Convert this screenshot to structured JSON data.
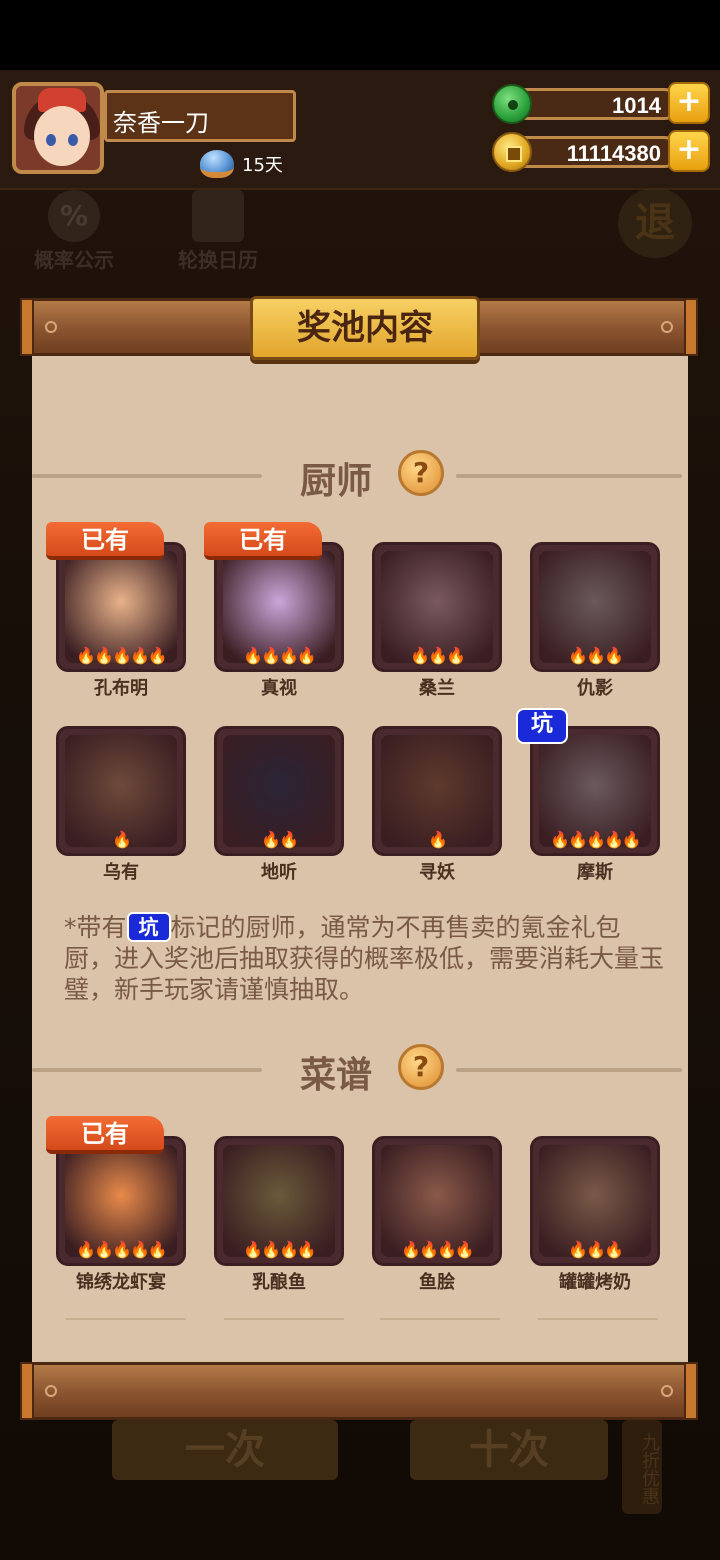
{
  "player": {
    "name": "奈香一刀",
    "days_label": "15天",
    "jade": "1014",
    "gold": "11114380"
  },
  "background": {
    "rate_label": "概率公示",
    "calendar_label": "轮换日历",
    "exit_label": "退",
    "btn_one": "一次",
    "btn_ten": "十次",
    "discount_label": "九折优惠",
    "rate_icon": "%"
  },
  "dialog": {
    "title": "奖池内容",
    "owned_label": "已有",
    "pit_label": "坑",
    "help_glyph": "?",
    "chef_section": "厨师",
    "recipe_section": "菜谱",
    "note_prefix": "*带有",
    "note_suffix": "标记的厨师，通常为不再售卖的氪金礼包厨，进入奖池后抽取获得的概率极低，需要消耗大量玉璧，新手玩家请谨慎抽取。"
  },
  "chefs": [
    {
      "name": "孔布明",
      "stars": 5,
      "owned": true,
      "pit": false,
      "color": "#e8b28a"
    },
    {
      "name": "真视",
      "stars": 4,
      "owned": true,
      "pit": false,
      "color": "#c9a6d9"
    },
    {
      "name": "桑兰",
      "stars": 3,
      "owned": false,
      "pit": false,
      "color": "#7a5a5e"
    },
    {
      "name": "仇影",
      "stars": 3,
      "owned": false,
      "pit": false,
      "color": "#6a5a5a"
    },
    {
      "name": "乌有",
      "stars": 1,
      "owned": false,
      "pit": false,
      "color": "#6e4a3a"
    },
    {
      "name": "地听",
      "stars": 2,
      "owned": false,
      "pit": false,
      "color": "#2a2436"
    },
    {
      "name": "寻妖",
      "stars": 1,
      "owned": false,
      "pit": false,
      "color": "#5e3a2c"
    },
    {
      "name": "摩斯",
      "stars": 5,
      "owned": false,
      "pit": true,
      "color": "#6a5a5e"
    }
  ],
  "recipes": [
    {
      "name": "锦绣龙虾宴",
      "stars": 5,
      "owned": true,
      "color": "#e88a4a"
    },
    {
      "name": "乳酿鱼",
      "stars": 4,
      "owned": false,
      "color": "#6a5a3a"
    },
    {
      "name": "鱼脍",
      "stars": 4,
      "owned": false,
      "color": "#8a5a4a"
    },
    {
      "name": "罐罐烤奶",
      "stars": 3,
      "owned": false,
      "color": "#7a5a48"
    }
  ],
  "flame_glyph": "🔥"
}
